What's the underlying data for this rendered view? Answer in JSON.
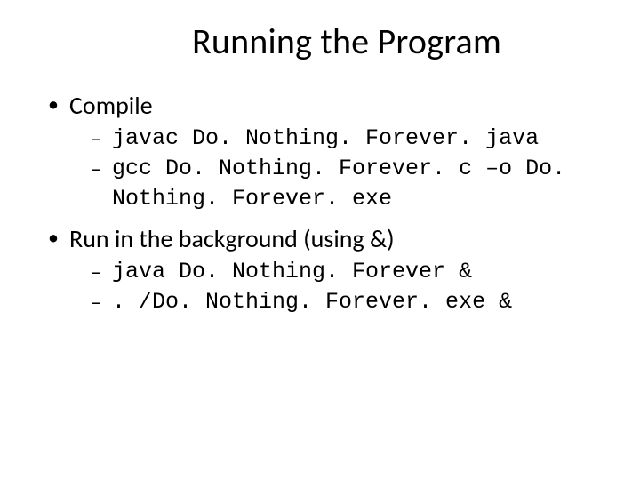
{
  "title": "Running the Program",
  "bullets": [
    {
      "label": "Compile",
      "sub": [
        "javac Do. Nothing. Forever. java",
        "gcc Do. Nothing. Forever. c –o Do. Nothing. Forever. exe"
      ]
    },
    {
      "label": "Run in the background (using &)",
      "sub": [
        "java Do. Nothing. Forever &",
        ". /Do. Nothing. Forever. exe &"
      ]
    }
  ]
}
